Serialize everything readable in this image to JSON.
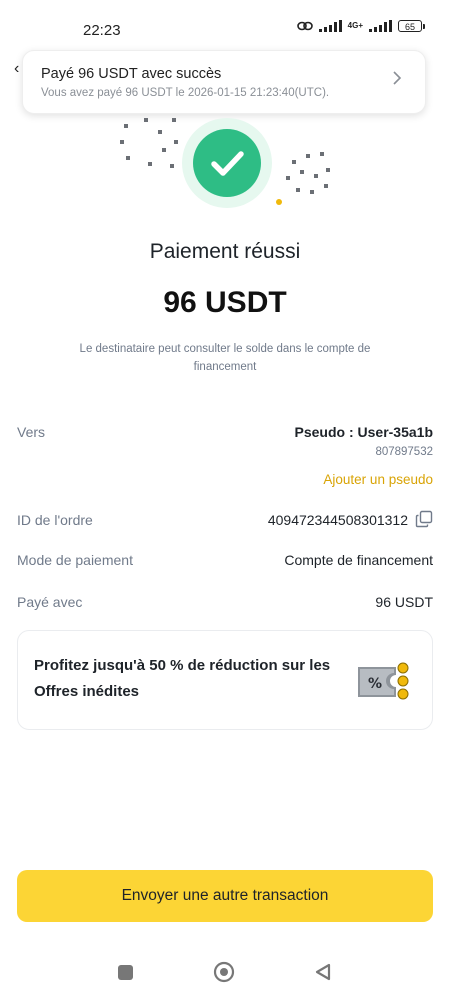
{
  "status_bar": {
    "time": "22:23",
    "network": "4G+",
    "battery": "65"
  },
  "notification": {
    "title": "Payé 96 USDT avec succès",
    "subtitle": "Vous avez payé 96 USDT le 2026-01-15 21:23:40(UTC)."
  },
  "result": {
    "title": "Paiement réussi",
    "amount": "96 USDT",
    "description": "Le destinataire peut consulter le solde dans le compte de financement"
  },
  "details": {
    "to_label": "Vers",
    "pseudo": "Pseudo : User-35a1b",
    "user_id": "807897532",
    "add_pseudo": "Ajouter un pseudo",
    "order_label": "ID de l'ordre",
    "order_id": "409472344508301312",
    "method_label": "Mode de paiement",
    "method_value": "Compte de financement",
    "paid_label": "Payé avec",
    "paid_value": "96 USDT"
  },
  "promo": {
    "text": "Profitez jusqu'à 50 % de réduction sur les Offres inédites",
    "icon": "discount-ticket-icon"
  },
  "cta": {
    "label": "Envoyer une autre transaction"
  },
  "colors": {
    "success": "#2EBD85",
    "accent": "#FCD535",
    "link": "#D9A406"
  }
}
